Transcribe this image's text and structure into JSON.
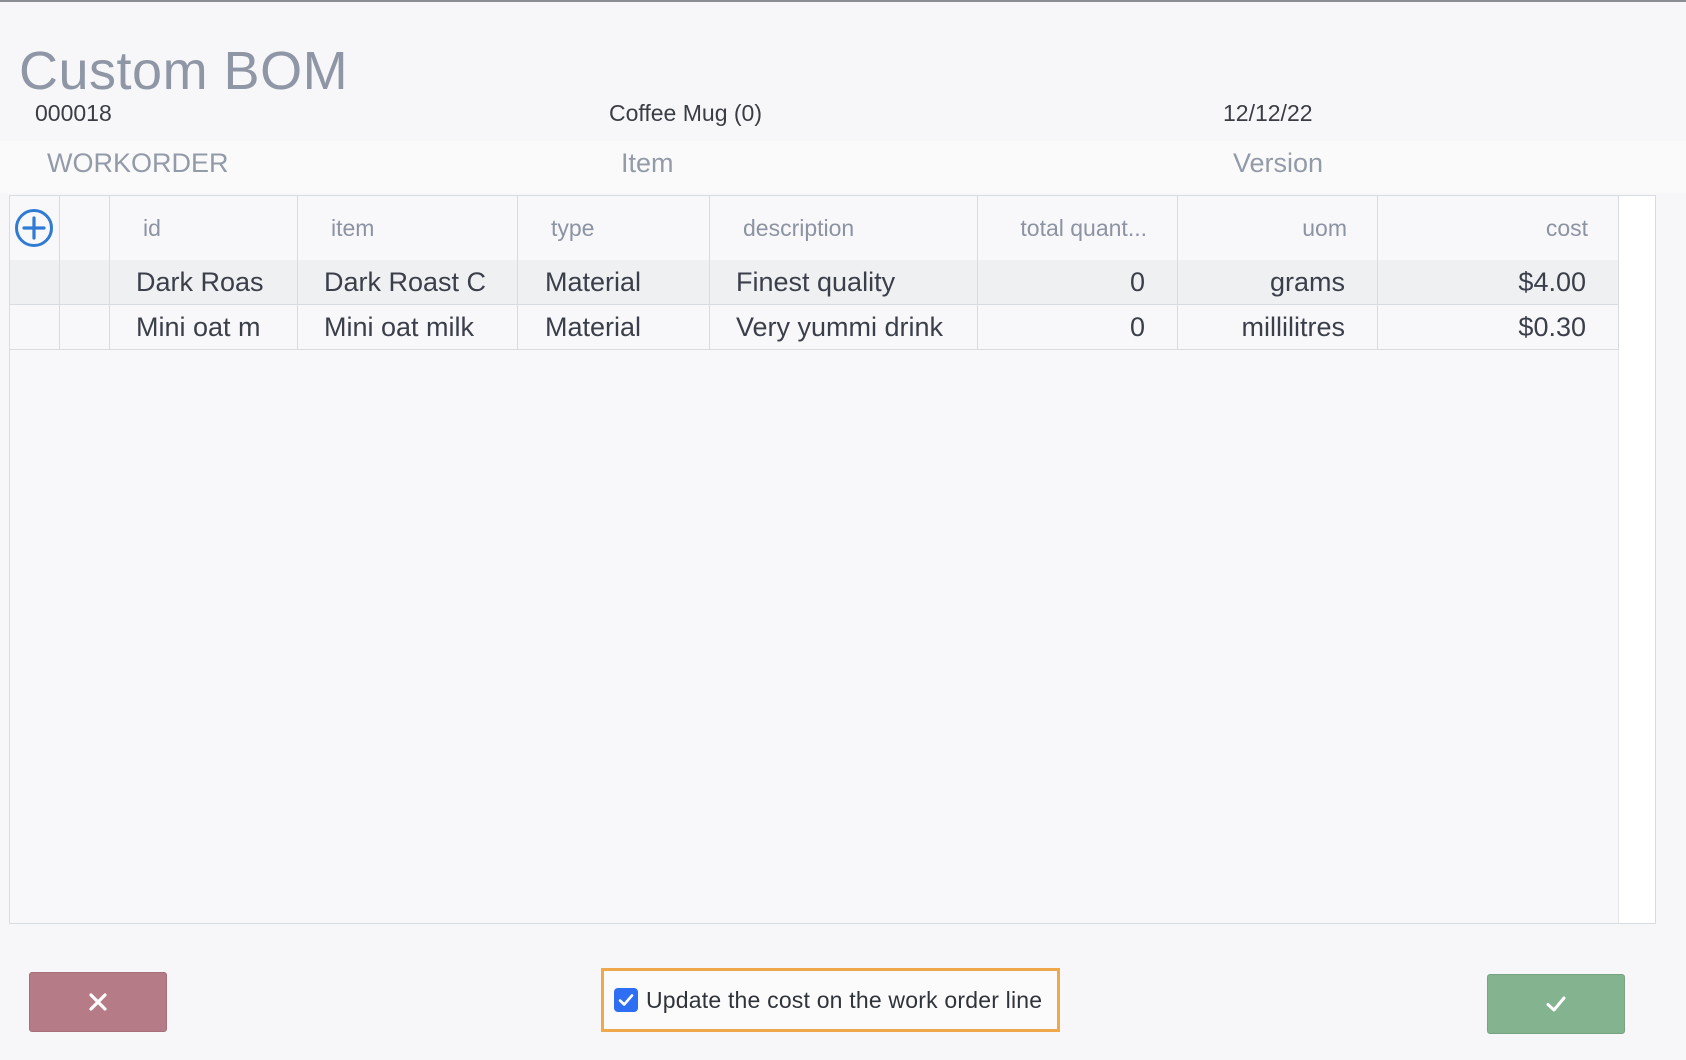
{
  "dialog": {
    "title": "Custom BOM"
  },
  "header": {
    "workorder_value": "000018",
    "item_value": "Coffee Mug (0)",
    "version_value": "12/12/22",
    "workorder_label": "WORKORDER",
    "item_label": "Item",
    "version_label": "Version"
  },
  "table": {
    "columns": [
      "id",
      "item",
      "type",
      "description",
      "total quant...",
      "uom",
      "cost"
    ],
    "rows": [
      {
        "id": "Dark Roas",
        "item": "Dark Roast C",
        "type": "Material",
        "description": "Finest quality",
        "total_quantity": "0",
        "uom": "grams",
        "cost": "$4.00"
      },
      {
        "id": "Mini oat m",
        "item": "Mini oat milk",
        "type": "Material",
        "description": "Very yummi drink",
        "total_quantity": "0",
        "uom": "millilitres",
        "cost": "$0.30"
      }
    ]
  },
  "footer": {
    "update_cost_label": "Update the cost on the work order line",
    "update_cost_checked": true,
    "cancel_icon": "close-icon",
    "confirm_icon": "check-icon"
  },
  "colors": {
    "cancel": "#b57b86",
    "confirm": "#84b48f",
    "checkbox": "#2e6ef2",
    "highlight": "#f0a94a",
    "add_icon": "#2f7bd4"
  }
}
